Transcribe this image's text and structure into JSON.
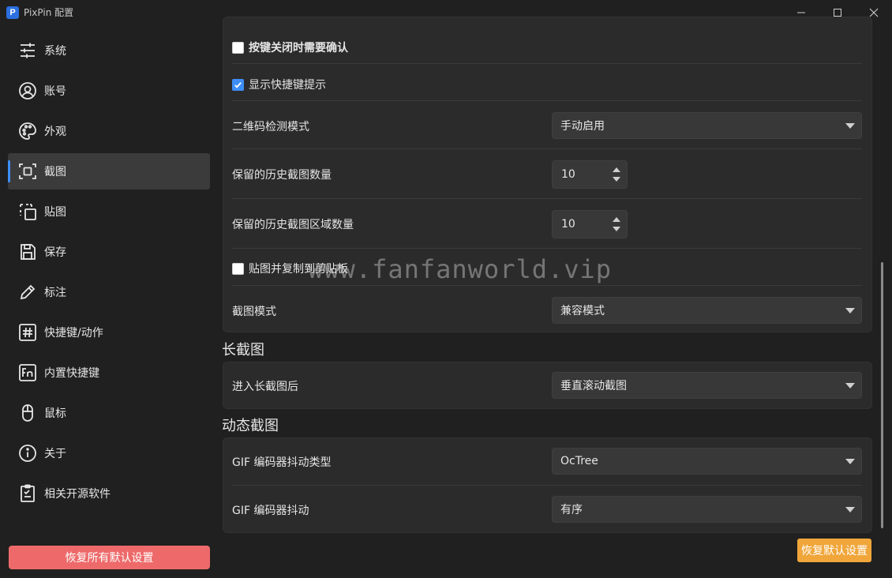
{
  "window": {
    "app_logo": "P",
    "title": "PixPin 配置",
    "controls": [
      "minimize-icon",
      "maximize-icon",
      "close-icon"
    ]
  },
  "sidebar": {
    "items": [
      {
        "label": "系统",
        "icon": "sliders-icon"
      },
      {
        "label": "账号",
        "icon": "user-icon"
      },
      {
        "label": "外观",
        "icon": "palette-icon"
      },
      {
        "label": "截图",
        "icon": "screenshot-icon",
        "active": true
      },
      {
        "label": "贴图",
        "icon": "pin-icon"
      },
      {
        "label": "保存",
        "icon": "save-icon"
      },
      {
        "label": "标注",
        "icon": "pencil-icon"
      },
      {
        "label": "快捷键/动作",
        "icon": "hashtag-icon"
      },
      {
        "label": "内置快捷键",
        "icon": "fn-key-icon"
      },
      {
        "label": "鼠标",
        "icon": "mouse-icon"
      },
      {
        "label": "关于",
        "icon": "info-icon"
      },
      {
        "label": "相关开源软件",
        "icon": "checklist-icon"
      }
    ],
    "reset_all_label": "恢复所有默认设置"
  },
  "screenshot_card": {
    "confirm_on_close": {
      "label": "按键关闭时需要确认",
      "checked": false
    },
    "show_shortcut_hints": {
      "label": "显示快捷键提示",
      "checked": true
    },
    "qr_detect_mode": {
      "label": "二维码检测模式",
      "value": "手动启用"
    },
    "history_count": {
      "label": "保留的历史截图数量",
      "value": "10"
    },
    "history_region_count": {
      "label": "保留的历史截图区域数量",
      "value": "10"
    },
    "pin_and_copy": {
      "label": "贴图并复制到剪贴板",
      "checked": false
    },
    "screenshot_mode": {
      "label": "截图模式",
      "value": "兼容模式"
    }
  },
  "long_screenshot": {
    "title": "长截图",
    "after_enter": {
      "label": "进入长截图后",
      "value": "垂直滚动截图"
    }
  },
  "animated_screenshot": {
    "title": "动态截图",
    "dither_type": {
      "label": "GIF 编码器抖动类型",
      "value": "OcTree"
    },
    "dither": {
      "label": "GIF 编码器抖动",
      "value": "有序"
    }
  },
  "watermark": "www.fanfanworld.vip",
  "reset_defaults_label": "恢复默认设置",
  "colors": {
    "accent": "#3e8ef7",
    "reset_all": "#ee6a6a",
    "reset": "#f0a63a"
  }
}
